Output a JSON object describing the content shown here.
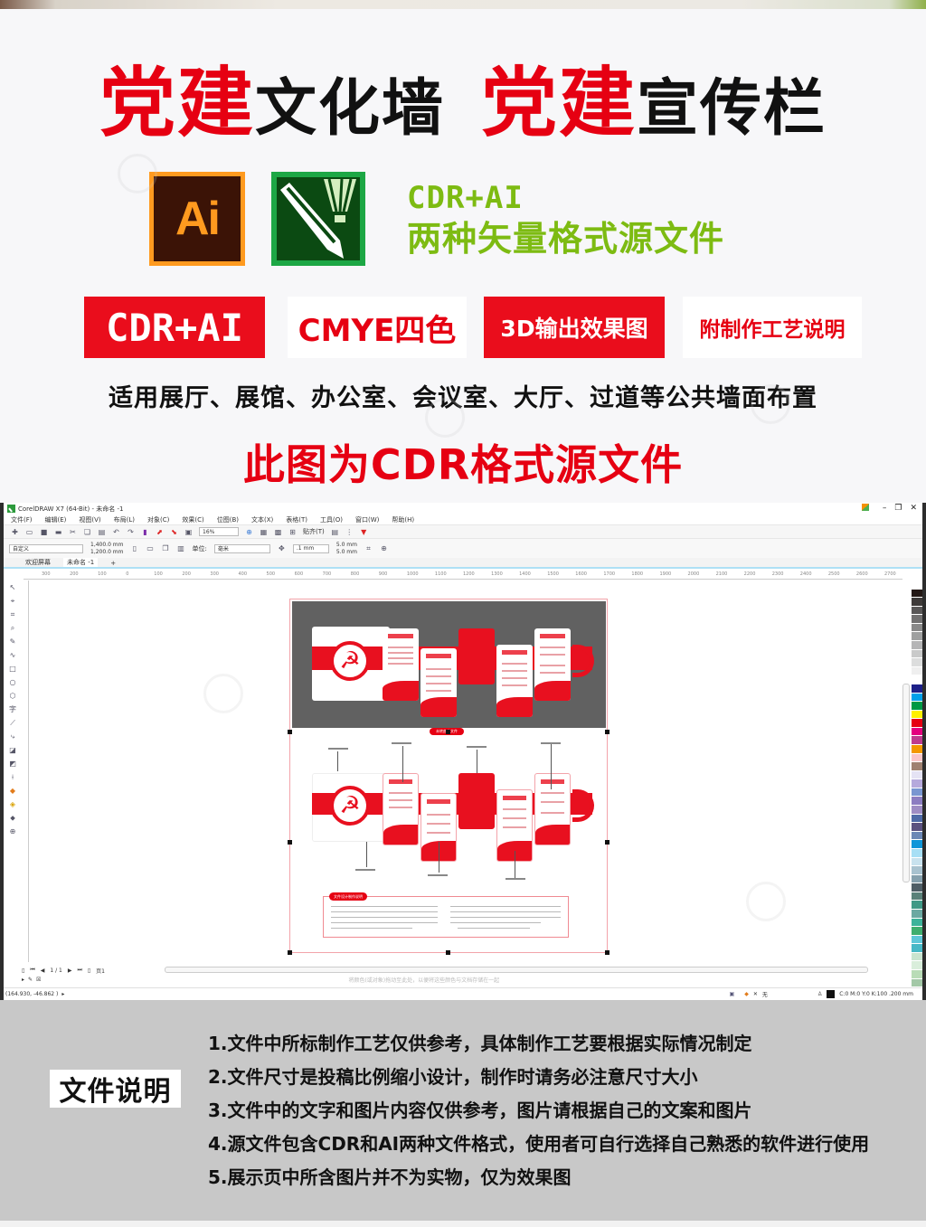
{
  "header": {
    "headline": [
      {
        "text": "党建",
        "style": "red"
      },
      {
        "text": "文化墙",
        "style": "black"
      },
      {
        "text": "党建",
        "style": "red"
      },
      {
        "text": "宣传栏",
        "style": "black"
      }
    ],
    "ai_icon_label": "Ai",
    "format_line1": "CDR+AI",
    "format_line2": "两种矢量格式源文件",
    "badges": [
      "CDR+AI",
      "CMYE四色",
      "3D输出效果图",
      "附制作工艺说明"
    ],
    "usage": "适用展厅、展馆、办公室、会议室、大厅、过道等公共墙面布置",
    "cdr_note": "此图为CDR格式源文件"
  },
  "colors": {
    "brand_red": "#e60012",
    "format_green": "#7dbb12",
    "ai_orange": "#ff9a1f",
    "cdr_green": "#1da745",
    "notes_bg": "#c8c8c8"
  },
  "coreldraw": {
    "title": "CorelDRAW X7 (64-Bit) - 未命名 -1",
    "window_controls": [
      "minimize",
      "restore",
      "close"
    ],
    "menu": [
      "文件(F)",
      "编辑(E)",
      "视图(V)",
      "布局(L)",
      "对象(C)",
      "效果(C)",
      "位图(B)",
      "文本(X)",
      "表格(T)",
      "工具(O)",
      "窗口(W)",
      "帮助(H)"
    ],
    "toolbar": {
      "zoom_level": "16%",
      "snap_label": "贴齐(T)"
    },
    "propbar": {
      "page_preset": "自定义",
      "width": "1,400.0 mm",
      "height": "1,200.0 mm",
      "units_label": "单位:",
      "units_value": "毫米",
      "nudge": ".1 mm",
      "dup_x": "5.0 mm",
      "dup_y": "5.0 mm"
    },
    "tabs": [
      "欢迎屏幕",
      "未命名 -1"
    ],
    "ruler_ticks": [
      "300",
      "200",
      "100",
      "0",
      "100",
      "200",
      "300",
      "400",
      "500",
      "600",
      "700",
      "800",
      "900",
      "1000",
      "1100",
      "1200",
      "1300",
      "1400",
      "1500",
      "1600",
      "1700",
      "1800",
      "1900",
      "2000",
      "2100",
      "2200",
      "2300",
      "2400",
      "2500",
      "2600",
      "2700"
    ],
    "artwork": {
      "pill_label": "未转曲的文件",
      "notes_title": "文件设计制作说明"
    },
    "pager": {
      "page_counter": "1 / 1",
      "page_tab": "页1"
    },
    "hint_text": "将颜色(或对象)拖动至此处，以便将这些颜色与文档存储在一起",
    "status": {
      "coordinates": "(164.930, -46.862 )",
      "fill_none": "无",
      "outline_info": "C:0 M:0 Y:0 K:100  .200 mm"
    },
    "palette": [
      "#ffffff",
      "#231815",
      "#3e3a39",
      "#595757",
      "#727171",
      "#898989",
      "#9fa0a0",
      "#b5b5b6",
      "#c9caca",
      "#dcdddd",
      "#efefef",
      "#ffffff",
      "#1d2088",
      "#00a0e9",
      "#009944",
      "#fff100",
      "#e60012",
      "#e4007f",
      "#be3b8f",
      "#f39800",
      "#f9c6c9",
      "#9f8170",
      "#e5e3f4",
      "#b6a9dc",
      "#7996d1",
      "#8c7dc1",
      "#9e8dc4",
      "#4e6aa7",
      "#5b5280",
      "#6b87b5",
      "#0f96d9",
      "#a7dff5",
      "#c8e2ee",
      "#a8c2cf",
      "#85a0ad",
      "#4f5e66",
      "#5a8179",
      "#3f9986",
      "#6ba9a2",
      "#3db39a",
      "#3fae6e",
      "#5fc7d8",
      "#47b8c6",
      "#c9e4cf",
      "#d9eedb",
      "#b9dcb7",
      "#a3c8a7"
    ]
  },
  "file_notes": {
    "title": "文件说明",
    "items": [
      "1.文件中所标制作工艺仅供参考，具体制作工艺要根据实际情况制定",
      "2.文件尺寸是投稿比例缩小设计，制作时请务必注意尺寸大小",
      "3.文件中的文字和图片内容仅供参考，图片请根据自己的文案和图片",
      "4.源文件包含CDR和AI两种文件格式，使用者可自行选择自己熟悉的软件进行使用",
      "5.展示页中所含图片并不为实物，仅为效果图"
    ]
  }
}
